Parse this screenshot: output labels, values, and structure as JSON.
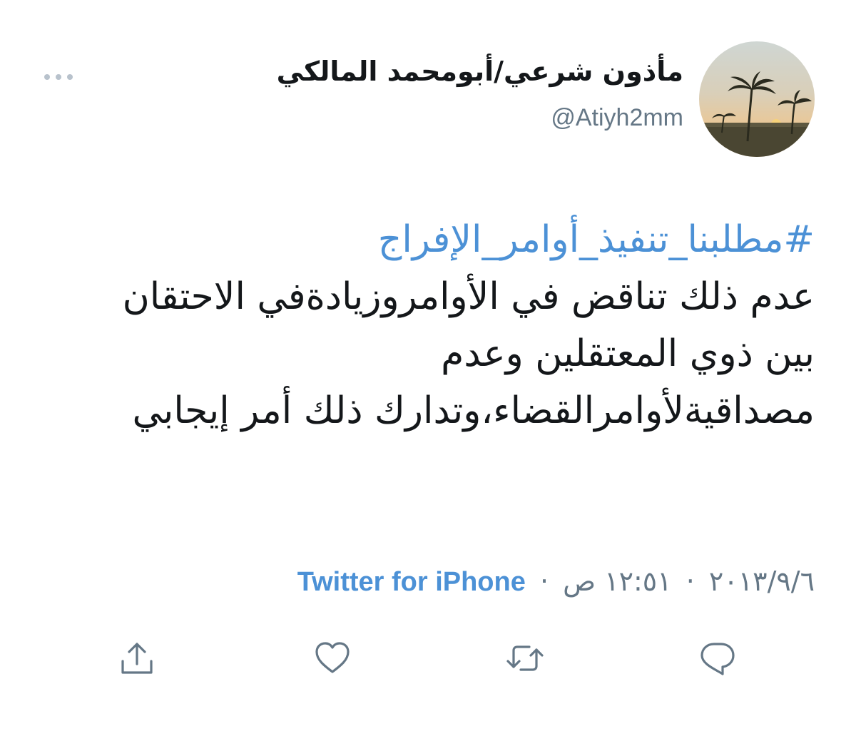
{
  "author": {
    "display_name": "مأذون شرعي/أبومحمد المالكي",
    "handle": "@Atiyh2mm"
  },
  "tweet": {
    "hashtag": "#مطلبنا_تنفيذ_أوامر_الإفراج",
    "text": "عدم ذلك تناقض في الأوامروزيادةفي الاحتقان بين ذوي المعتقلين وعدم مصداقيةلأوامرالقضاء،وتدارك ذلك أمر إيجابي"
  },
  "meta": {
    "date": "٢٠١٣/٩/٦",
    "separator": "·",
    "time": "١٢:٥١ ص",
    "source": "Twitter for iPhone"
  },
  "icons": {
    "more": "more-dots-icon",
    "reply": "reply-icon",
    "retweet": "retweet-icon",
    "like": "heart-icon",
    "share": "share-icon"
  },
  "colors": {
    "link": "#4c91d6",
    "secondary_text": "#657786",
    "icon": "#657786",
    "text": "#14171a"
  }
}
